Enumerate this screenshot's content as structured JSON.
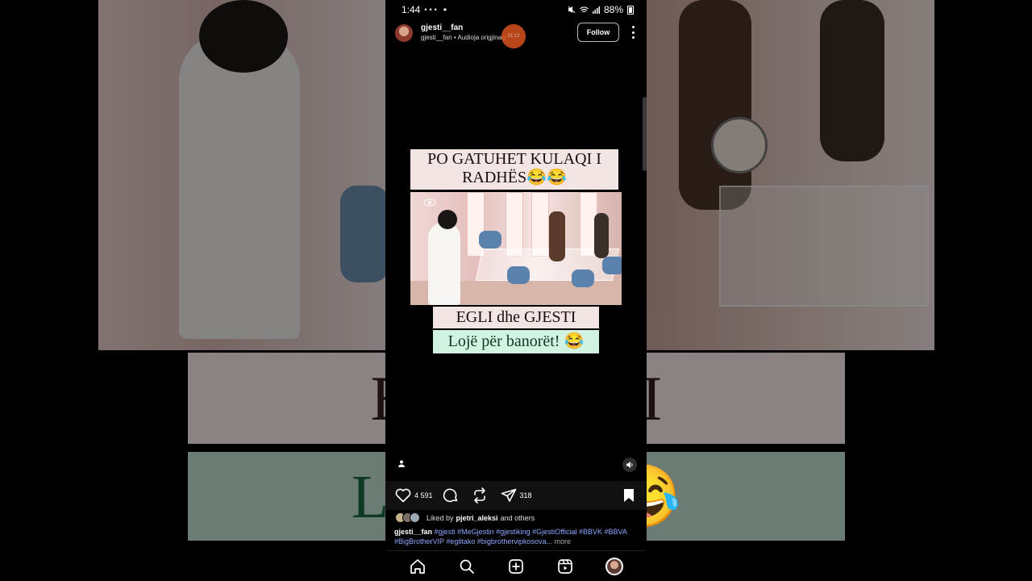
{
  "status_bar": {
    "time": "1:44",
    "notification_icons": "•••",
    "dot": "•",
    "battery": "88%"
  },
  "post": {
    "username": "gjesti__fan",
    "audio_label": "gjesti__fan • Audioja origjinale",
    "recording_badge": "01:13",
    "follow_label": "Follow"
  },
  "video": {
    "title_text": "PO GATUHET KULAQI I RADHËS😂😂",
    "subtitle_names": "EGLI dhe GJESTI",
    "subtitle_game": "Lojë për banorët! 😂"
  },
  "background": {
    "caption_top": "EGLI        ESTI",
    "caption_bottom": "Lojë p          ët! 😂"
  },
  "actions": {
    "likes": "4 591",
    "shares": "318"
  },
  "liked_by": {
    "prefix": "Liked by",
    "name": "pjetri_aleksi",
    "suffix": "and others"
  },
  "caption": {
    "user": "gjesti__fan",
    "line1_tags": "#gjesti #MeGjestin #gjestiking #GjestiOfficial #BBVK #BBVA",
    "line2_tags": "#BigBrotherVIP #eglitako #bigbrothervipkosova...",
    "more": "more"
  },
  "colors": {
    "title_bg": "#f3e5e4",
    "green_bg": "#d2f3e2",
    "hashtag": "#8ea6ff"
  },
  "icons": {
    "like": "heart-icon",
    "comment": "comment-icon",
    "repost": "repost-icon",
    "share": "send-icon",
    "save": "bookmark-icon",
    "nav": [
      "home-icon",
      "search-icon",
      "create-icon",
      "reels-icon",
      "profile-avatar"
    ]
  }
}
